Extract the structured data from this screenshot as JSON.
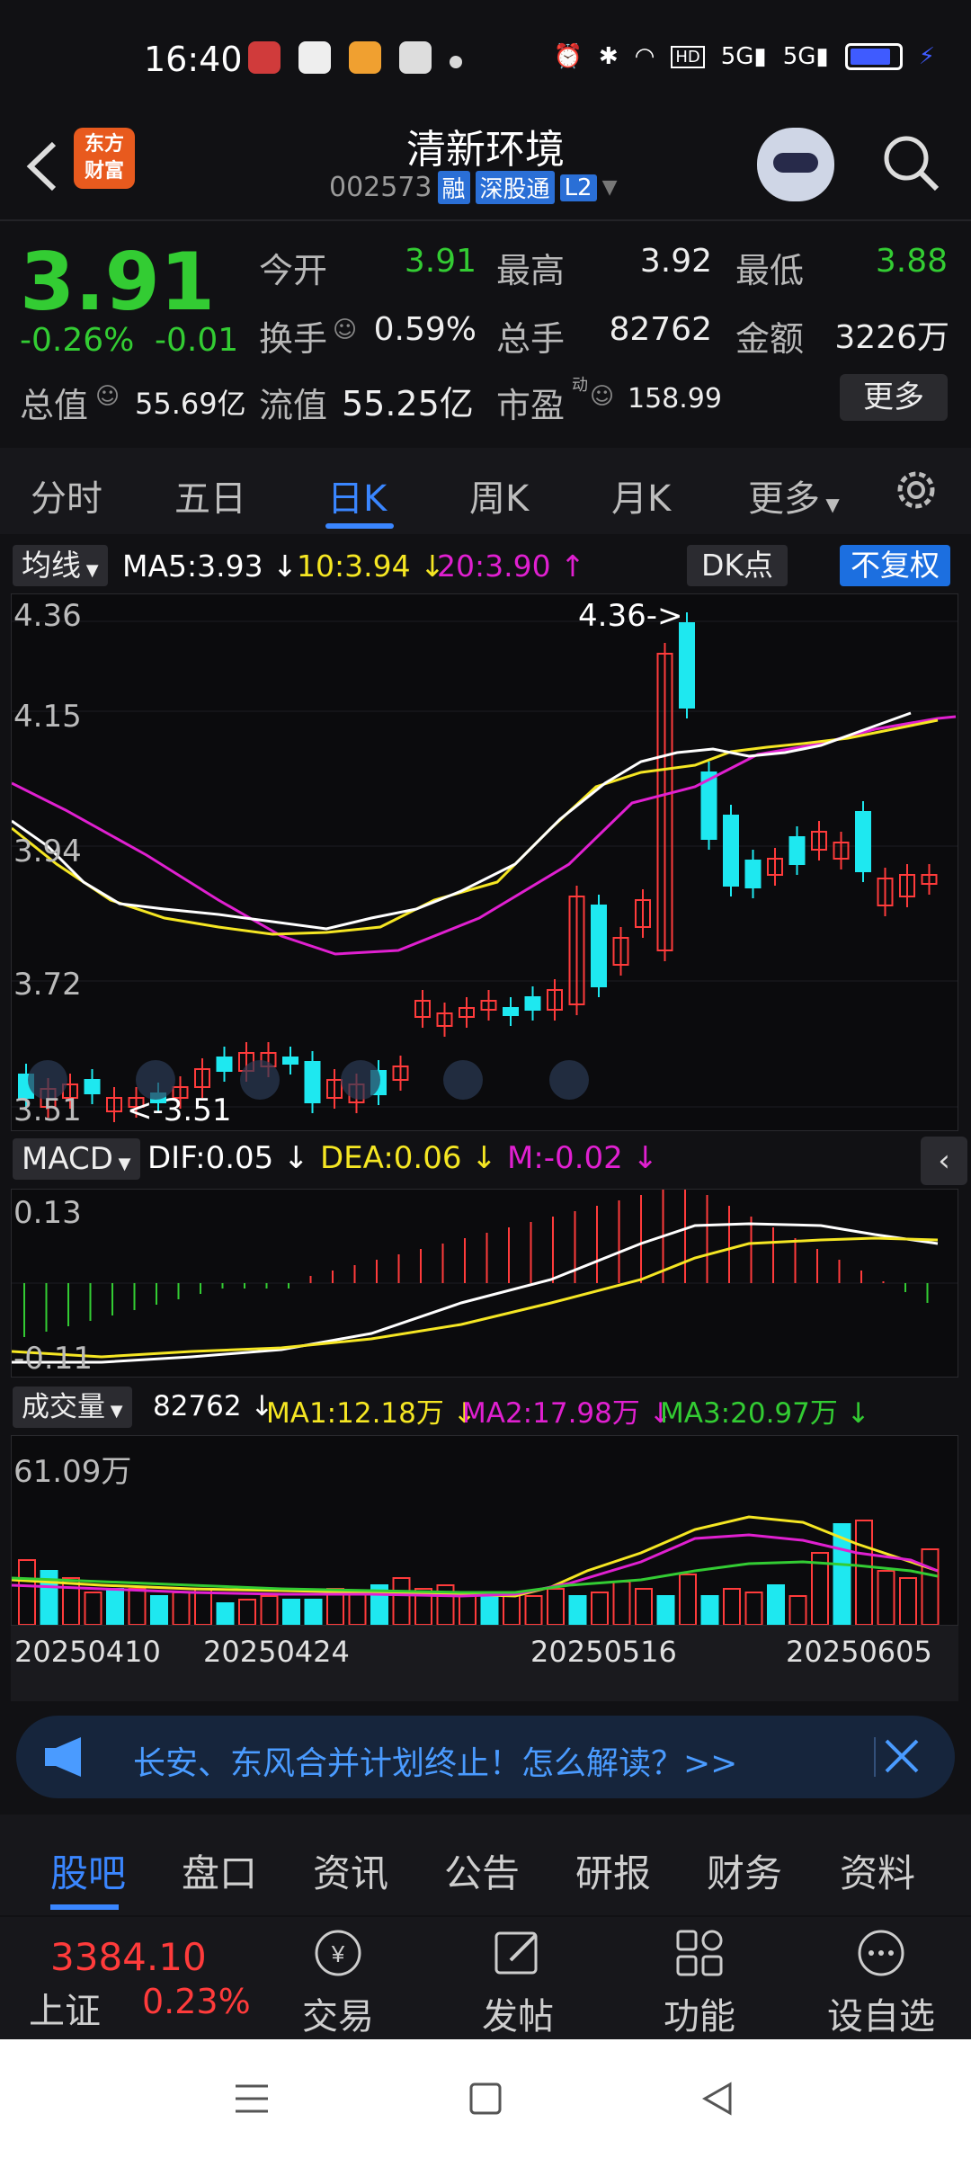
{
  "status": {
    "time": "16:40"
  },
  "header": {
    "logo_text": [
      "东方",
      "财富"
    ],
    "title": "清新环境",
    "code": "002573",
    "tags": [
      "融",
      "深股通",
      "L2"
    ]
  },
  "quote": {
    "price": "3.91",
    "change_pct": "-0.26%",
    "change": "-0.01",
    "open_label": "今开",
    "open": "3.91",
    "high_label": "最高",
    "high": "3.92",
    "low_label": "最低",
    "low": "3.88",
    "turnover_label": "换手",
    "turnover": "0.59%",
    "volume_label": "总手",
    "volume": "82762",
    "amount_label": "金额",
    "amount": "3226万",
    "mktcap_label": "总值",
    "mktcap": "55.69亿",
    "float_label": "流值",
    "float": "55.25亿",
    "pe_label": "市盈",
    "pe_sup": "动",
    "pe": "158.99",
    "more_label": "更多"
  },
  "tabs": [
    "分时",
    "五日",
    "日K",
    "周K",
    "月K",
    "更多"
  ],
  "ma": {
    "btn": "均线",
    "ma5": "MA5:3.93",
    "ma10": "10:3.94",
    "ma20": "20:3.90",
    "dk": "DK点",
    "fq": "不复权"
  },
  "kline": {
    "ticks": [
      "4.36",
      "4.15",
      "3.94",
      "3.72",
      "3.51"
    ],
    "max_note": "4.36->",
    "min_note": "<-3.51"
  },
  "macd": {
    "btn": "MACD",
    "dif": "DIF:0.05",
    "dea": "DEA:0.06",
    "m": "M:-0.02",
    "top": "0.13",
    "bottom": "-0.11"
  },
  "vol": {
    "btn": "成交量",
    "v": "82762",
    "ma1": "MA1:12.18万",
    "ma2": "MA2:17.98万",
    "ma3": "MA3:20.97万",
    "top": "61.09万"
  },
  "dates": [
    "20250410",
    "20250424",
    "20250516",
    "20250605"
  ],
  "banner": {
    "text": "长安、东风合并计划终止！怎么解读？>>"
  },
  "bottom_tabs": [
    "股吧",
    "盘口",
    "资讯",
    "公告",
    "研报",
    "财务",
    "资料"
  ],
  "toolbar": {
    "index_value": "3384.10",
    "index_name": "上证",
    "index_pct": "0.23%",
    "tools": [
      "交易",
      "发帖",
      "功能",
      "设自选"
    ]
  },
  "colors": {
    "up": "#ff3b3b",
    "down": "#1ee8f0",
    "ma5": "#ffffff",
    "ma10": "#f5e623",
    "ma20": "#e020d0",
    "accent": "#3a86ff"
  }
}
